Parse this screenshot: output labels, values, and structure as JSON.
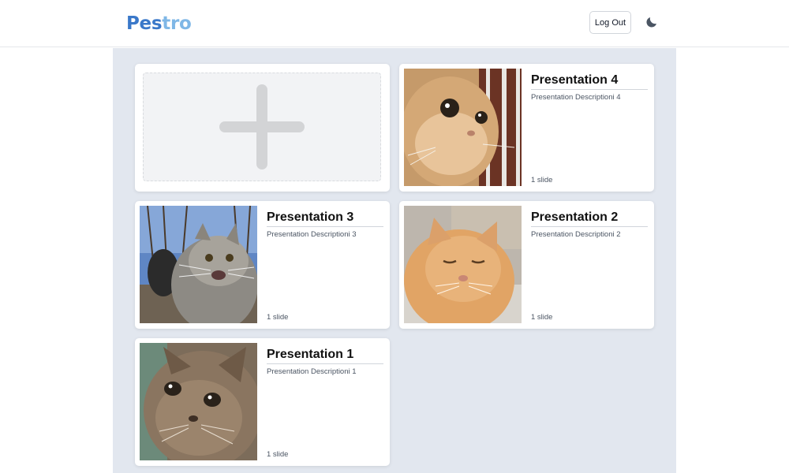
{
  "header": {
    "logo_part1": "Pes",
    "logo_part2": "tro",
    "logout_label": "Log Out",
    "theme_icon": "moon-icon"
  },
  "new_card": {
    "icon": "plus-icon"
  },
  "presentations": [
    {
      "title": "Presentation 4",
      "description": "Presentation Descriptioni 4",
      "slides": "1 slide",
      "thumbnail": "cat-photo"
    },
    {
      "title": "Presentation 3",
      "description": "Presentation Descriptioni 3",
      "slides": "1 slide",
      "thumbnail": "cat-photo"
    },
    {
      "title": "Presentation 2",
      "description": "Presentation Descriptioni 2",
      "slides": "1 slide",
      "thumbnail": "cat-photo"
    },
    {
      "title": "Presentation 1",
      "description": "Presentation Descriptioni 1",
      "slides": "1 slide",
      "thumbnail": "cat-photo"
    }
  ],
  "colors": {
    "brand_dark": "#3a78c9",
    "brand_light": "#7fb7e6",
    "content_bg": "#e2e7ef"
  }
}
